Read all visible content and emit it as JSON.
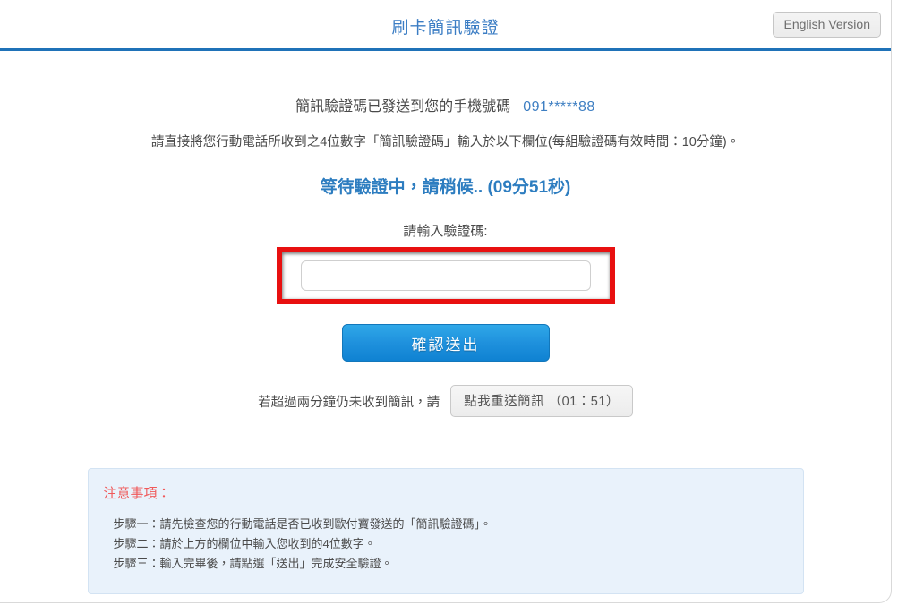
{
  "header": {
    "title": "刷卡簡訊驗證",
    "lang_button": "English Version"
  },
  "main": {
    "sent_notice": "簡訊驗證碼已發送到您的手機號碼",
    "phone_masked": "091*****88",
    "instruction": "請直接將您行動電話所收到之4位數字「簡訊驗證碼」輸入於以下欄位(每組驗證碼有效時間：10分鐘)。",
    "waiting_status": "等待驗證中，請稍候.. (09分51秒)",
    "input_label": "請輸入驗證碼:",
    "code_value": "",
    "code_placeholder": "",
    "submit_label": "確認送出",
    "resend_note": "若超過兩分鐘仍未收到簡訊，請",
    "resend_button": "點我重送簡訊 （01：51）"
  },
  "notice": {
    "title": "注意事項：",
    "steps": [
      "步驟一：請先檢查您的行動電話是否已收到歐付寶發送的「簡訊驗證碼」。",
      "步驟二：請於上方的欄位中輸入您收到的4位數字。",
      "步驟三：輸入完畢後，請點選「送出」完成安全驗證。"
    ]
  },
  "colors": {
    "accent_blue": "#1f72b8",
    "title_blue": "#3b7dc4",
    "status_blue": "#2d7dc0",
    "highlight_red": "#e81010",
    "notice_red": "#f0595a",
    "notice_bg": "#e9f2fb"
  }
}
